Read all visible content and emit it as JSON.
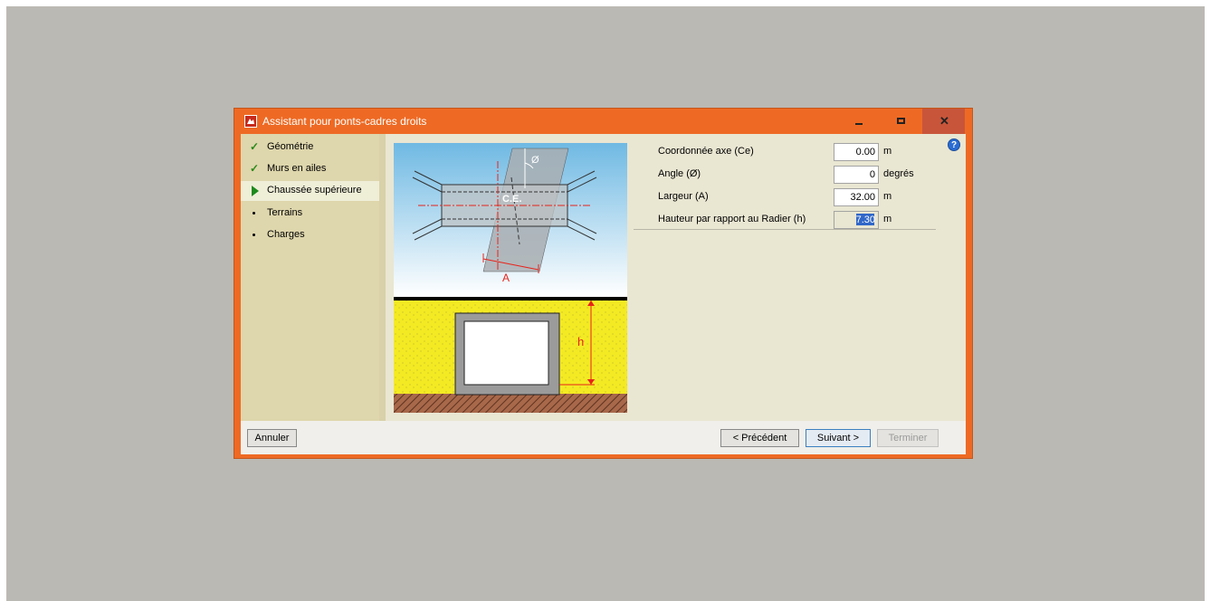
{
  "window": {
    "title": "Assistant pour ponts-cadres droits"
  },
  "steps": [
    {
      "label": "Géométrie",
      "state": "done",
      "icon": "check-icon"
    },
    {
      "label": "Murs en ailes",
      "state": "done",
      "icon": "check-icon"
    },
    {
      "label": "Chaussée supérieure",
      "state": "current",
      "icon": "arrow-right-icon"
    },
    {
      "label": "Terrains",
      "state": "pending",
      "icon": "bullet-icon"
    },
    {
      "label": "Charges",
      "state": "pending",
      "icon": "bullet-icon"
    }
  ],
  "diagram": {
    "phi_label": "Ø",
    "ce_label": "C.E.",
    "a_label": "A",
    "h_label": "h"
  },
  "fields": [
    {
      "label": "Coordonnée axe (Ce)",
      "value": "0.00",
      "unit": "m"
    },
    {
      "label": "Angle (Ø)",
      "value": "0",
      "unit": "degrés"
    },
    {
      "label": "Largeur (A)",
      "value": "32.00",
      "unit": "m"
    },
    {
      "label": "Hauteur par rapport au Radier (h)",
      "value": "7.30",
      "unit": "m",
      "selected": true
    }
  ],
  "buttons": {
    "cancel": "Annuler",
    "previous": "< Précédent",
    "next": "Suivant >",
    "finish": "Terminer"
  },
  "colors": {
    "titlebar": "#ee6a24",
    "sidebar": "#ded6ac",
    "sky": "#6fb9e3",
    "soil": "#f4ea23",
    "dimension_red": "#e8231b"
  }
}
